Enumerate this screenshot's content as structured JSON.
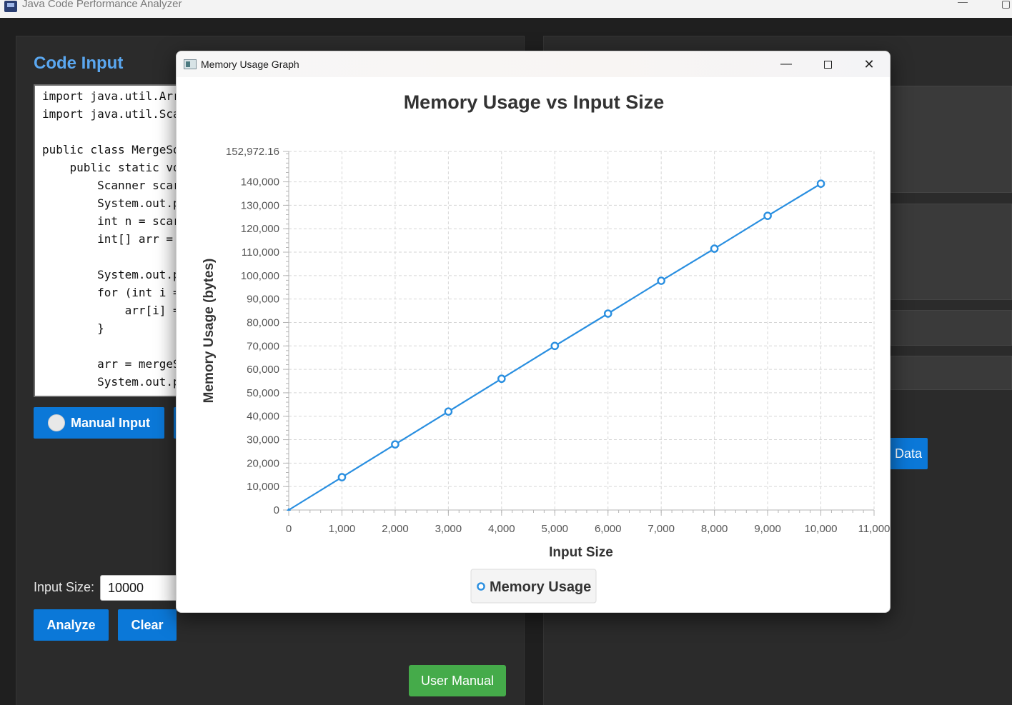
{
  "window": {
    "title": "Java Code Performance Analyzer",
    "minimize_glyph": "—"
  },
  "left_panel": {
    "title": "Code Input",
    "code_lines": [
      "import java.util.Arr",
      "import java.util.Sca",
      "",
      "public class MergeSo",
      "    public static vo",
      "        Scanner scar",
      "        System.out.p",
      "        int n = scar",
      "        int[] arr = ",
      "",
      "        System.out.p",
      "        for (int i =",
      "            arr[i] =",
      "        }",
      "",
      "        arr = mergeS",
      "        System.out.p"
    ],
    "manual_input_label": "Manual Input",
    "input_size_label": "Input Size:",
    "input_size_value": "10000",
    "analyze_label": "Analyze",
    "clear_label": "Clear",
    "user_manual_label": "User Manual"
  },
  "right_panel": {
    "data_button_label": "Data"
  },
  "dialog": {
    "title": "Memory Usage Graph",
    "close_glyph": "✕",
    "minimize_glyph": "—"
  },
  "colors": {
    "accent": "#0b78d8",
    "series": "#2a8fe0",
    "green": "#45ab4a",
    "title_blue": "#5aa7f0"
  },
  "chart_data": {
    "type": "line",
    "title": "Memory Usage vs Input Size",
    "xlabel": "Input Size",
    "ylabel": "Memory Usage (bytes)",
    "xlim": [
      0,
      11000
    ],
    "ylim": [
      0,
      152972.16
    ],
    "x_ticks": [
      0,
      1000,
      2000,
      3000,
      4000,
      5000,
      6000,
      7000,
      8000,
      9000,
      10000,
      11000
    ],
    "y_ticks": [
      0,
      10000,
      20000,
      30000,
      40000,
      50000,
      60000,
      70000,
      80000,
      90000,
      100000,
      110000,
      120000,
      130000,
      140000
    ],
    "y_top_label": "152,972.16",
    "grid": true,
    "legend_position": "bottom",
    "series": [
      {
        "name": "Memory Usage",
        "x": [
          0,
          1000,
          2000,
          3000,
          4000,
          5000,
          6000,
          7000,
          8000,
          9000,
          10000
        ],
        "values": [
          0,
          14000,
          28000,
          42000,
          56000,
          70000,
          83800,
          97800,
          111500,
          125500,
          139200
        ]
      }
    ]
  }
}
